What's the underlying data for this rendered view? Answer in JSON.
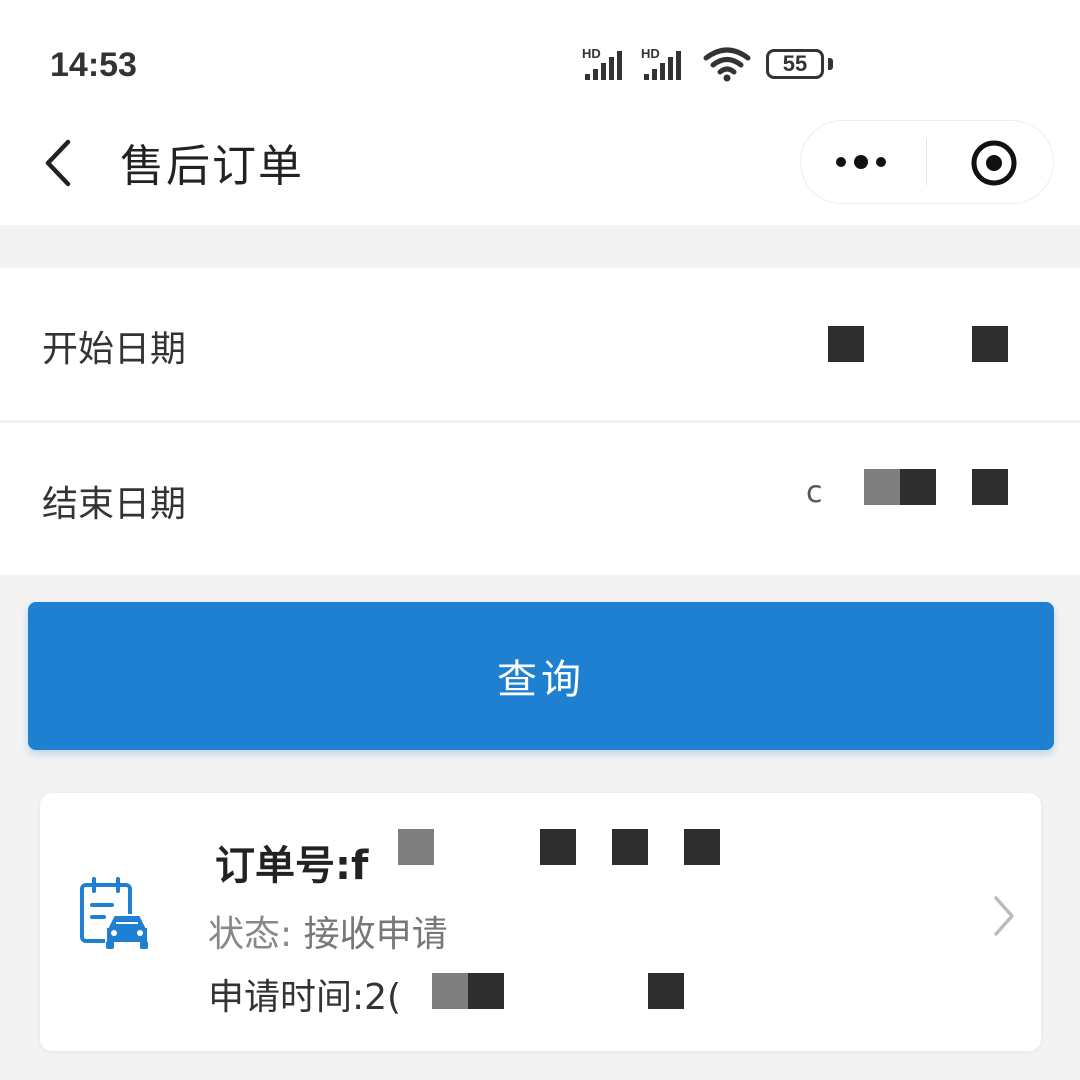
{
  "status_bar": {
    "time": "14:53",
    "signal1_label": "HD",
    "signal2_label": "HD",
    "battery": "55"
  },
  "nav": {
    "title": "售后订单",
    "icons": {
      "back": "chevron-left",
      "more": "three-dots",
      "close": "record-circle"
    }
  },
  "form": {
    "start_label": "开始日期",
    "end_label": "结束日期",
    "end_value_visible": "c"
  },
  "query_button": "查询",
  "order": {
    "number_label": "订单号:f",
    "status_label": "状态:",
    "status_value": "接收申请",
    "time_label": "申请时间:2(",
    "icon": "calendar-car-icon"
  },
  "colors": {
    "primary": "#1f80d1",
    "background": "#f3f3f3"
  }
}
